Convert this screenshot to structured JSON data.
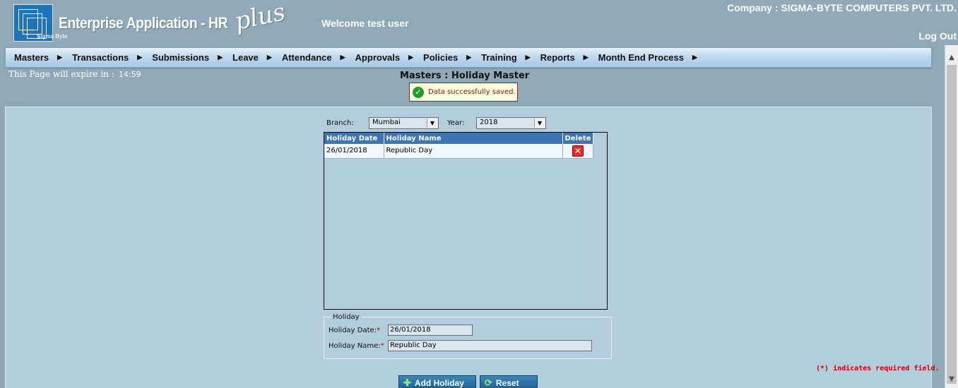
{
  "header": {
    "app_title": "Enterprise Application - HR",
    "app_title_script": "plus",
    "logo_caption": "Sigma Byte",
    "welcome": "Welcome test user",
    "company": "Company : SIGMA-BYTE COMPUTERS PVT. LTD.",
    "logout": "Log Out"
  },
  "menu": [
    {
      "label": "Masters"
    },
    {
      "label": "Transactions"
    },
    {
      "label": "Submissions"
    },
    {
      "label": "Leave"
    },
    {
      "label": "Attendance"
    },
    {
      "label": "Approvals"
    },
    {
      "label": "Policies"
    },
    {
      "label": "Training"
    },
    {
      "label": "Reports"
    },
    {
      "label": "Month End Process"
    }
  ],
  "session": {
    "expire_label": "This Page will expire in :",
    "timer": "14:59"
  },
  "page": {
    "title": "Masters : Holiday Master",
    "alert": "Data successfully saved."
  },
  "filters": {
    "branch_label": "Branch:",
    "branch_value": "Mumbai",
    "year_label": "Year:",
    "year_value": "2018"
  },
  "grid": {
    "headers": [
      "Holiday Date",
      "Holiday Name",
      "Delete"
    ],
    "rows": [
      {
        "date": "26/01/2018",
        "name": "Republic Day"
      }
    ]
  },
  "form": {
    "legend": "Holiday",
    "date_label": "Holiday Date:",
    "date_value": "26/01/2018",
    "name_label": "Holiday Name:",
    "name_value": "Republic Day",
    "required_marker": "*",
    "required_note": "(*) indicates required field."
  },
  "buttons": {
    "add": "Add Holiday",
    "reset": "Reset"
  },
  "colors": {
    "background": "#8fa9b9",
    "panel": "#b2cddb",
    "grid_header": "#3b75b5",
    "button": "#175e8f",
    "required": "#cc0000"
  }
}
